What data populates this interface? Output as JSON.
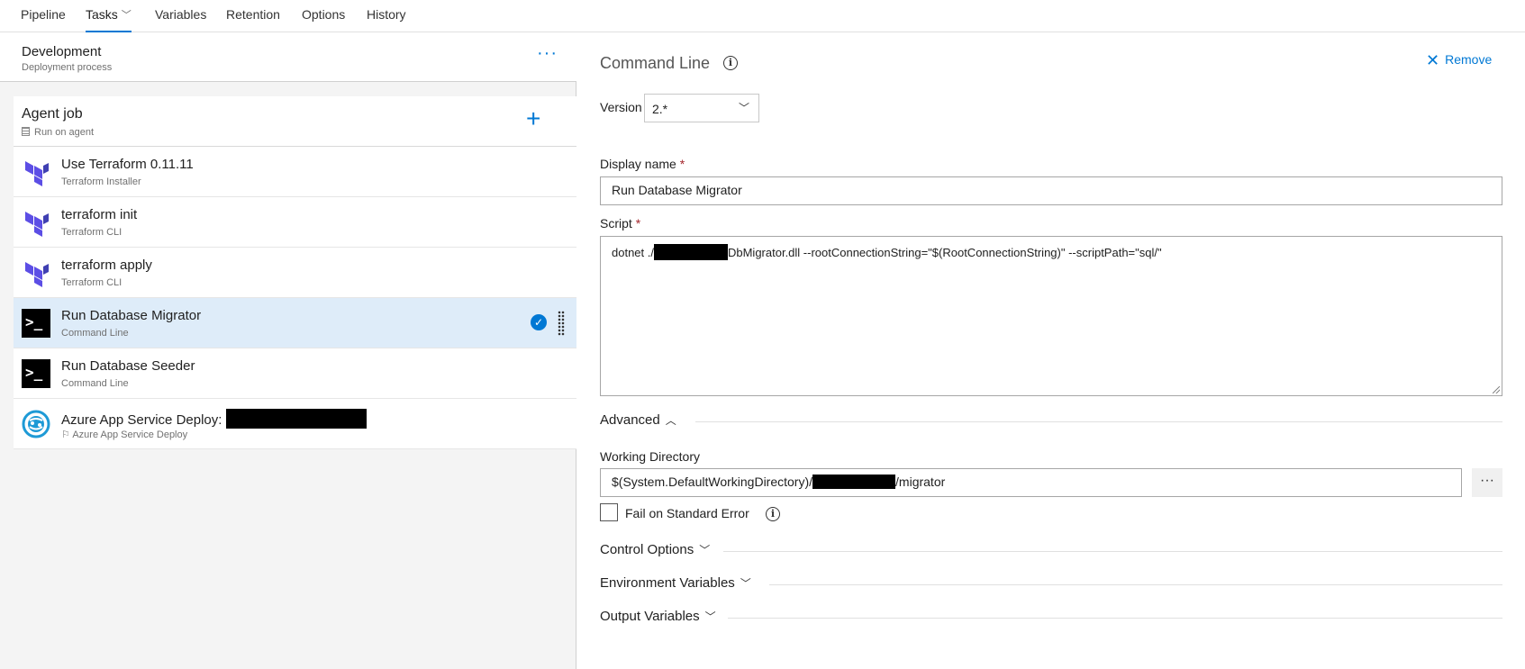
{
  "nav": {
    "tabs": [
      "Pipeline",
      "Tasks",
      "Variables",
      "Retention",
      "Options",
      "History"
    ],
    "active_tab": "Tasks"
  },
  "stage": {
    "title": "Development",
    "subtitle": "Deployment process",
    "more_label": "···"
  },
  "job": {
    "title": "Agent job",
    "subtitle": "Run on agent",
    "add_label": "+"
  },
  "tasks": [
    {
      "title": "Use Terraform 0.11.11",
      "subtitle": "Terraform Installer",
      "icon": "terraform-icon"
    },
    {
      "title": "terraform init",
      "subtitle": "Terraform CLI",
      "icon": "terraform-icon"
    },
    {
      "title": "terraform apply",
      "subtitle": "Terraform CLI",
      "icon": "terraform-icon"
    },
    {
      "title": "Run Database Migrator",
      "subtitle": "Command Line",
      "icon": "terminal-icon",
      "selected": true
    },
    {
      "title": "Run Database Seeder",
      "subtitle": "Command Line",
      "icon": "terminal-icon"
    },
    {
      "title": "Azure App Service Deploy:",
      "subtitle": "Azure App Service Deploy",
      "icon": "azure-app-service-icon"
    }
  ],
  "detail": {
    "title": "Command Line",
    "remove_label": "Remove",
    "version_label": "Version",
    "version_value": "2.*",
    "display_name_label": "Display name",
    "display_name_value": "Run Database Migrator",
    "script_label": "Script",
    "script_prefix": "dotnet ./",
    "script_suffix": "DbMigrator.dll --rootConnectionString=\"$(RootConnectionString)\" --scriptPath=\"sql/\"",
    "advanced_label": "Advanced",
    "working_dir_label": "Working Directory",
    "working_dir_prefix": "$(System.DefaultWorkingDirectory)/",
    "working_dir_suffix": "/migrator",
    "fail_on_stderr_label": "Fail on Standard Error",
    "control_options_label": "Control Options",
    "env_vars_label": "Environment Variables",
    "output_vars_label": "Output Variables"
  },
  "colors": {
    "accent": "#0078d4",
    "selected_row": "#deecf9",
    "terraform": "#5c4ee5",
    "azure": "#1e9ad6"
  }
}
